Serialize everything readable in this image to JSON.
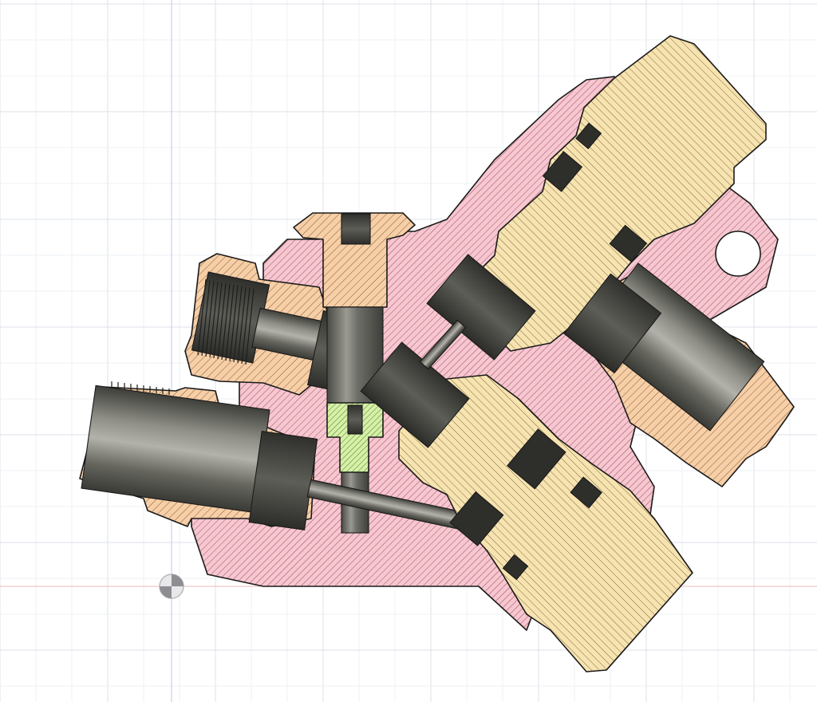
{
  "viewport": {
    "mode": "section-analysis",
    "background": "#ffffff",
    "grid_minor_color": "#eef0f4",
    "grid_major_color": "#dde1e8",
    "axis_x_color": "#f2b9b9",
    "axis_y_color": "#c0c4ee",
    "origin_icon": "origin-point-icon"
  },
  "materials": {
    "body": {
      "fill": "#f6c7d0",
      "hatch": "#8a2a3c"
    },
    "port_fitting": {
      "fill": "#f6cfa7",
      "hatch": "#6a3a1a"
    },
    "valve_bonnet": {
      "fill": "#f7e3b0",
      "hatch": "#5a4a20"
    },
    "seat_insert": {
      "fill": "#d6f0a8",
      "hatch": "#3e6a14"
    },
    "bore_steel": {
      "fill": "#5a5a54",
      "highlight": "#a8a8a0"
    }
  }
}
